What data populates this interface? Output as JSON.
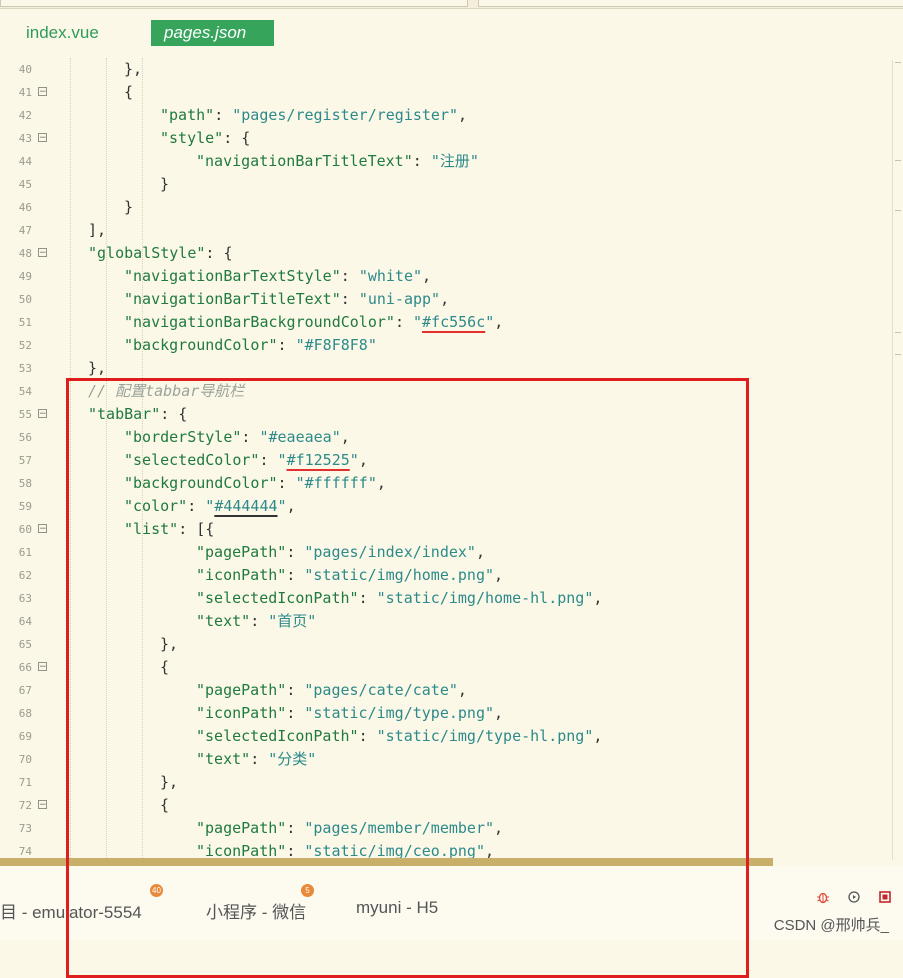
{
  "tabs": [
    {
      "label": "index.vue",
      "active": false
    },
    {
      "label": "pages.json",
      "active": true
    }
  ],
  "colors": {
    "key": "#1f7a3e",
    "string": "#2c8a8a",
    "comment": "#9aa29a",
    "tab_active_bg": "#37a45c",
    "annotation_box": "#e01e1e"
  },
  "code_lines": [
    {
      "n": "40",
      "fold": false,
      "indent": 2,
      "segs": [
        [
          "p",
          "},"
        ]
      ]
    },
    {
      "n": "41",
      "fold": true,
      "indent": 2,
      "segs": [
        [
          "p",
          "{"
        ]
      ]
    },
    {
      "n": "42",
      "fold": false,
      "indent": 3,
      "segs": [
        [
          "k",
          "\"path\""
        ],
        [
          "p",
          ": "
        ],
        [
          "s",
          "\"pages/register/register\""
        ],
        [
          "p",
          ","
        ]
      ]
    },
    {
      "n": "43",
      "fold": true,
      "indent": 3,
      "segs": [
        [
          "k",
          "\"style\""
        ],
        [
          "p",
          ": {"
        ]
      ]
    },
    {
      "n": "44",
      "fold": false,
      "indent": 4,
      "segs": [
        [
          "k",
          "\"navigationBarTitleText\""
        ],
        [
          "p",
          ": "
        ],
        [
          "s",
          "\"注册\""
        ]
      ]
    },
    {
      "n": "45",
      "fold": false,
      "indent": 3,
      "segs": [
        [
          "p",
          "}"
        ]
      ]
    },
    {
      "n": "46",
      "fold": false,
      "indent": 2,
      "segs": [
        [
          "p",
          "}"
        ]
      ]
    },
    {
      "n": "47",
      "fold": false,
      "indent": 1,
      "segs": [
        [
          "p",
          "],"
        ]
      ]
    },
    {
      "n": "48",
      "fold": true,
      "indent": 1,
      "segs": [
        [
          "k",
          "\"globalStyle\""
        ],
        [
          "p",
          ": {"
        ]
      ]
    },
    {
      "n": "49",
      "fold": false,
      "indent": 2,
      "segs": [
        [
          "k",
          "\"navigationBarTextStyle\""
        ],
        [
          "p",
          ": "
        ],
        [
          "s",
          "\"white\""
        ],
        [
          "p",
          ","
        ]
      ]
    },
    {
      "n": "50",
      "fold": false,
      "indent": 2,
      "segs": [
        [
          "k",
          "\"navigationBarTitleText\""
        ],
        [
          "p",
          ": "
        ],
        [
          "s",
          "\"uni-app\""
        ],
        [
          "p",
          ","
        ]
      ]
    },
    {
      "n": "51",
      "fold": false,
      "indent": 2,
      "segs": [
        [
          "k",
          "\"navigationBarBackgroundColor\""
        ],
        [
          "p",
          ": "
        ],
        [
          "s",
          "\""
        ],
        [
          "s ul-red",
          "#fc556c"
        ],
        [
          "s",
          "\""
        ],
        [
          "p",
          ","
        ]
      ]
    },
    {
      "n": "52",
      "fold": false,
      "indent": 2,
      "segs": [
        [
          "k",
          "\"backgroundColor\""
        ],
        [
          "p",
          ": "
        ],
        [
          "s",
          "\"#F8F8F8\""
        ]
      ]
    },
    {
      "n": "53",
      "fold": false,
      "indent": 1,
      "segs": [
        [
          "p",
          "},"
        ]
      ]
    },
    {
      "n": "54",
      "fold": false,
      "indent": 1,
      "segs": [
        [
          "c",
          "// 配置tabbar导航栏"
        ]
      ]
    },
    {
      "n": "55",
      "fold": true,
      "indent": 1,
      "segs": [
        [
          "k",
          "\"tabBar\""
        ],
        [
          "p",
          ": {"
        ]
      ]
    },
    {
      "n": "56",
      "fold": false,
      "indent": 2,
      "segs": [
        [
          "k",
          "\"borderStyle\""
        ],
        [
          "p",
          ": "
        ],
        [
          "s",
          "\"#eaeaea\""
        ],
        [
          "p",
          ","
        ]
      ]
    },
    {
      "n": "57",
      "fold": false,
      "indent": 2,
      "segs": [
        [
          "k",
          "\"selectedColor\""
        ],
        [
          "p",
          ": "
        ],
        [
          "s",
          "\""
        ],
        [
          "s ul-red",
          "#f12525"
        ],
        [
          "s",
          "\""
        ],
        [
          "p",
          ","
        ]
      ]
    },
    {
      "n": "58",
      "fold": false,
      "indent": 2,
      "segs": [
        [
          "k",
          "\"backgroundColor\""
        ],
        [
          "p",
          ": "
        ],
        [
          "s",
          "\"#ffffff\""
        ],
        [
          "p",
          ","
        ]
      ]
    },
    {
      "n": "59",
      "fold": false,
      "indent": 2,
      "segs": [
        [
          "k",
          "\"color\""
        ],
        [
          "p",
          ": "
        ],
        [
          "s",
          "\""
        ],
        [
          "s ul-dark",
          "#444444"
        ],
        [
          "s",
          "\""
        ],
        [
          "p",
          ","
        ]
      ]
    },
    {
      "n": "60",
      "fold": true,
      "indent": 2,
      "segs": [
        [
          "k",
          "\"list\""
        ],
        [
          "p",
          ": [{"
        ]
      ]
    },
    {
      "n": "61",
      "fold": false,
      "indent": 4,
      "segs": [
        [
          "k",
          "\"pagePath\""
        ],
        [
          "p",
          ": "
        ],
        [
          "s",
          "\"pages/index/index\""
        ],
        [
          "p",
          ","
        ]
      ]
    },
    {
      "n": "62",
      "fold": false,
      "indent": 4,
      "segs": [
        [
          "k",
          "\"iconPath\""
        ],
        [
          "p",
          ": "
        ],
        [
          "s",
          "\"static/img/home.png\""
        ],
        [
          "p",
          ","
        ]
      ]
    },
    {
      "n": "63",
      "fold": false,
      "indent": 4,
      "segs": [
        [
          "k",
          "\"selectedIconPath\""
        ],
        [
          "p",
          ": "
        ],
        [
          "s",
          "\"static/img/home-hl.png\""
        ],
        [
          "p",
          ","
        ]
      ]
    },
    {
      "n": "64",
      "fold": false,
      "indent": 4,
      "segs": [
        [
          "k",
          "\"text\""
        ],
        [
          "p",
          ": "
        ],
        [
          "s",
          "\"首页\""
        ]
      ]
    },
    {
      "n": "65",
      "fold": false,
      "indent": 3,
      "segs": [
        [
          "p",
          "},"
        ]
      ]
    },
    {
      "n": "66",
      "fold": true,
      "indent": 3,
      "segs": [
        [
          "p",
          "{"
        ]
      ]
    },
    {
      "n": "67",
      "fold": false,
      "indent": 4,
      "segs": [
        [
          "k",
          "\"pagePath\""
        ],
        [
          "p",
          ": "
        ],
        [
          "s",
          "\"pages/cate/cate\""
        ],
        [
          "p",
          ","
        ]
      ]
    },
    {
      "n": "68",
      "fold": false,
      "indent": 4,
      "segs": [
        [
          "k",
          "\"iconPath\""
        ],
        [
          "p",
          ": "
        ],
        [
          "s",
          "\"static/img/type.png\""
        ],
        [
          "p",
          ","
        ]
      ]
    },
    {
      "n": "69",
      "fold": false,
      "indent": 4,
      "segs": [
        [
          "k",
          "\"selectedIconPath\""
        ],
        [
          "p",
          ": "
        ],
        [
          "s",
          "\"static/img/type-hl.png\""
        ],
        [
          "p",
          ","
        ]
      ]
    },
    {
      "n": "70",
      "fold": false,
      "indent": 4,
      "segs": [
        [
          "k",
          "\"text\""
        ],
        [
          "p",
          ": "
        ],
        [
          "s",
          "\"分类\""
        ]
      ]
    },
    {
      "n": "71",
      "fold": false,
      "indent": 3,
      "segs": [
        [
          "p",
          "},"
        ]
      ]
    },
    {
      "n": "72",
      "fold": true,
      "indent": 3,
      "segs": [
        [
          "p",
          "{"
        ]
      ]
    },
    {
      "n": "73",
      "fold": false,
      "indent": 4,
      "segs": [
        [
          "k",
          "\"pagePath\""
        ],
        [
          "p",
          ": "
        ],
        [
          "s",
          "\"pages/member/member\""
        ],
        [
          "p",
          ","
        ]
      ]
    },
    {
      "n": "74",
      "fold": false,
      "indent": 4,
      "segs": [
        [
          "k",
          "\"iconPath\""
        ],
        [
          "p",
          ": "
        ],
        [
          "s",
          "\"static/img/ceo.png\""
        ],
        [
          "p",
          ","
        ]
      ]
    }
  ],
  "status": {
    "items": [
      {
        "label": "目 - emulator-5554",
        "badge": "40"
      },
      {
        "label": "小程序 - 微信",
        "badge": "5"
      },
      {
        "label": "myuni - H5",
        "badge": ""
      }
    ],
    "watermark": "CSDN @邢帅兵_"
  },
  "icons": [
    "bug-icon",
    "refresh-icon",
    "stop-icon"
  ]
}
